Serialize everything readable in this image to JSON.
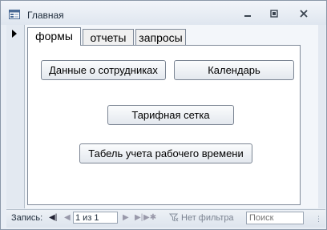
{
  "window": {
    "title": "Главная",
    "icons": {
      "app": "form-icon",
      "minimize": "minimize-icon",
      "restore": "restore-icon",
      "close": "close-icon"
    }
  },
  "tabs": [
    {
      "label": "формы",
      "selected": true
    },
    {
      "label": "отчеты",
      "selected": false
    },
    {
      "label": "запросы",
      "selected": false
    }
  ],
  "buttons": {
    "employees": "Данные о сотрудниках",
    "calendar": "Календарь",
    "tariff": "Тарифная сетка",
    "timesheet": "Табель учета рабочего времени"
  },
  "navigation": {
    "record_label": "Запись:",
    "current_record": "1 из 1",
    "filter_label": "Нет фильтра",
    "search_placeholder": "Поиск"
  },
  "colors": {
    "tab_border": "#7f8a99",
    "window_border": "#8a97a8"
  }
}
